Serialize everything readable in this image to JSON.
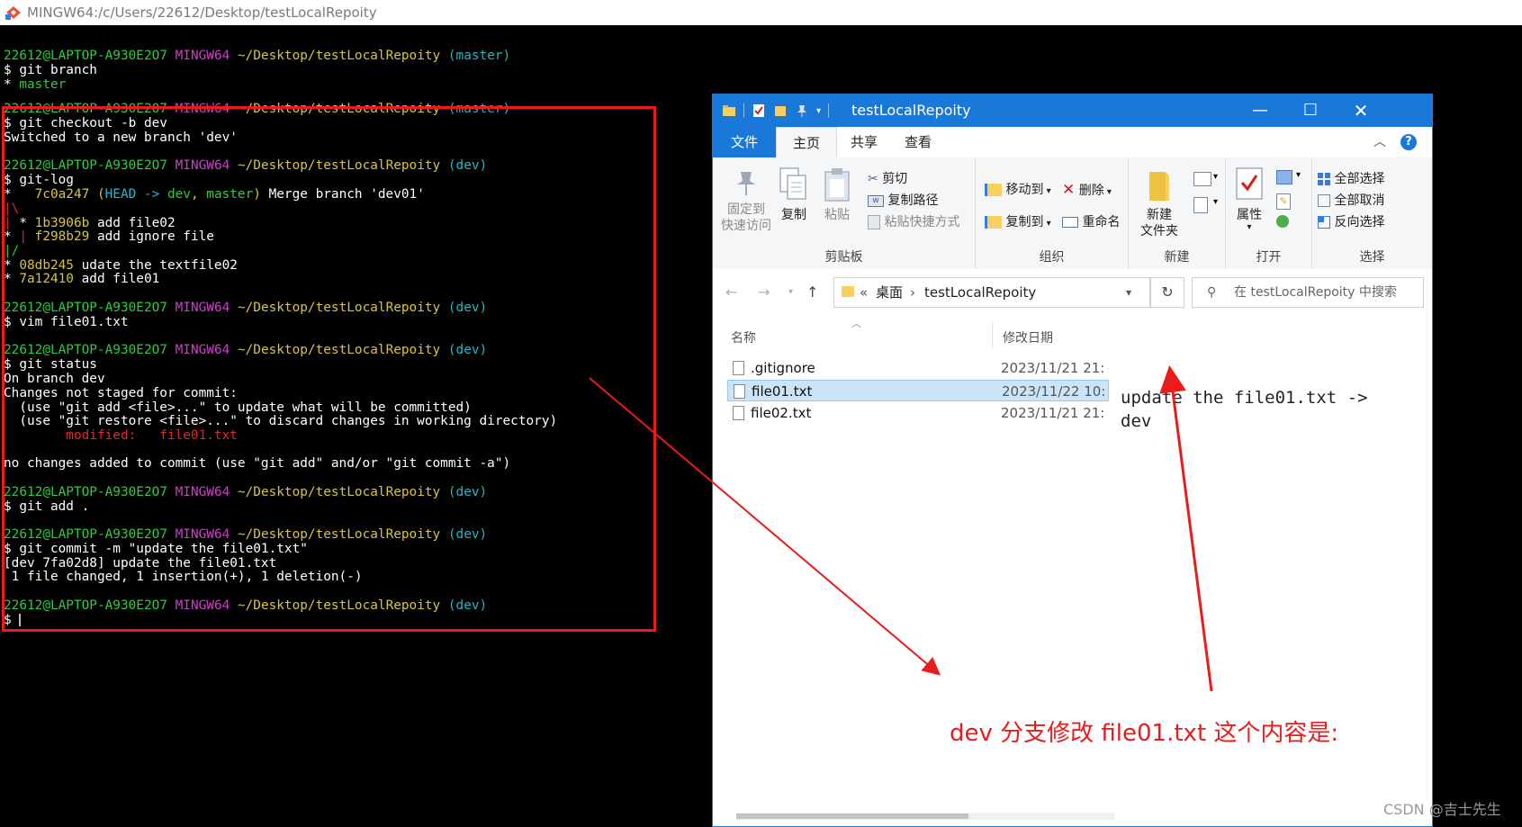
{
  "window_title": "MINGW64:/c/Users/22612/Desktop/testLocalRepoity",
  "terminal": {
    "lines": [
      {
        "prompt": {
          "user": "22612@LAPTOP-A930E2O7",
          "host": "MINGW64",
          "path": "~/Desktop/testLocalRepoity",
          "branch": "(master)"
        }
      },
      {
        "text": "$ git branch"
      },
      {
        "parts": [
          {
            "t": "* ",
            "cls": ""
          },
          {
            "t": "master",
            "cls": "g"
          }
        ]
      },
      {
        "prompt": {
          "user": "22612@LAPTOP-A930E2O7",
          "host": "MINGW64",
          "path": "~/Desktop/testLocalRepoity",
          "branch": "(master)"
        }
      },
      {
        "text": "$ git checkout -b dev"
      },
      {
        "text": "Switched to a new branch 'dev'"
      },
      {
        "prompt": {
          "user": "22612@LAPTOP-A930E2O7",
          "host": "MINGW64",
          "path": "~/Desktop/testLocalRepoity",
          "branch": "(dev)"
        }
      },
      {
        "text": "$ git-log"
      },
      {
        "parts": [
          {
            "t": "*   ",
            "cls": ""
          },
          {
            "t": "7c0a247",
            "cls": "y"
          },
          {
            "t": " (",
            "cls": "y"
          },
          {
            "t": "HEAD -> ",
            "cls": "c"
          },
          {
            "t": "dev",
            "cls": "g"
          },
          {
            "t": ", ",
            "cls": "y"
          },
          {
            "t": "master",
            "cls": "g"
          },
          {
            "t": ")",
            "cls": "y"
          },
          {
            "t": " Merge branch 'dev01'",
            "cls": ""
          }
        ]
      },
      {
        "parts": [
          {
            "t": "|\\",
            "cls": "r"
          }
        ]
      },
      {
        "parts": [
          {
            "t": "| ",
            "cls": "r"
          },
          {
            "t": "* ",
            "cls": ""
          },
          {
            "t": "1b3906b",
            "cls": "y"
          },
          {
            "t": " add file02",
            "cls": ""
          }
        ]
      },
      {
        "parts": [
          {
            "t": "* ",
            "cls": ""
          },
          {
            "t": "| ",
            "cls": "r"
          },
          {
            "t": "f298b29",
            "cls": "y"
          },
          {
            "t": " add ignore file",
            "cls": ""
          }
        ]
      },
      {
        "parts": [
          {
            "t": "|/",
            "cls": "g"
          }
        ]
      },
      {
        "parts": [
          {
            "t": "* ",
            "cls": ""
          },
          {
            "t": "08db245",
            "cls": "y"
          },
          {
            "t": " udate the textfile02",
            "cls": ""
          }
        ]
      },
      {
        "parts": [
          {
            "t": "* ",
            "cls": ""
          },
          {
            "t": "7a12410",
            "cls": "y"
          },
          {
            "t": " add file01",
            "cls": ""
          }
        ]
      },
      {
        "prompt": {
          "user": "22612@LAPTOP-A930E2O7",
          "host": "MINGW64",
          "path": "~/Desktop/testLocalRepoity",
          "branch": "(dev)"
        }
      },
      {
        "text": "$ vim file01.txt"
      },
      {
        "prompt": {
          "user": "22612@LAPTOP-A930E2O7",
          "host": "MINGW64",
          "path": "~/Desktop/testLocalRepoity",
          "branch": "(dev)"
        }
      },
      {
        "text": "$ git status"
      },
      {
        "text": "On branch dev"
      },
      {
        "text": "Changes not staged for commit:"
      },
      {
        "text": "  (use \"git add <file>...\" to update what will be committed)"
      },
      {
        "text": "  (use \"git restore <file>...\" to discard changes in working directory)"
      },
      {
        "parts": [
          {
            "t": "        modified:   file01.txt",
            "cls": "r"
          }
        ]
      },
      {
        "text": "no changes added to commit (use \"git add\" and/or \"git commit -a\")"
      },
      {
        "prompt": {
          "user": "22612@LAPTOP-A930E2O7",
          "host": "MINGW64",
          "path": "~/Desktop/testLocalRepoity",
          "branch": "(dev)"
        }
      },
      {
        "text": "$ git add ."
      },
      {
        "prompt": {
          "user": "22612@LAPTOP-A930E2O7",
          "host": "MINGW64",
          "path": "~/Desktop/testLocalRepoity",
          "branch": "(dev)"
        }
      },
      {
        "text": "$ git commit -m \"update the file01.txt\""
      },
      {
        "text": "[dev 7fa02d8] update the file01.txt"
      },
      {
        "text": " 1 file changed, 1 insertion(+), 1 deletion(-)"
      },
      {
        "prompt": {
          "user": "22612@LAPTOP-A930E2O7",
          "host": "MINGW64",
          "path": "~/Desktop/testLocalRepoity",
          "branch": "(dev)"
        }
      },
      {
        "text": "$ ",
        "cursor": true
      }
    ]
  },
  "explorer": {
    "title": "testLocalRepoity",
    "tabs": [
      "文件",
      "主页",
      "共享",
      "查看"
    ],
    "ribbon": {
      "pin": "固定到\n快速访问",
      "copy": "复制",
      "paste": "粘贴",
      "cut": "剪切",
      "copy_path": "复制路径",
      "paste_shortcut": "粘贴快捷方式",
      "clipboard_group": "剪贴板",
      "move_to": "移动到",
      "copy_to": "复制到",
      "delete": "删除",
      "rename": "重命名",
      "organize_group": "组织",
      "new_folder": "新建\n文件夹",
      "new_group": "新建",
      "properties": "属性",
      "open_group": "打开",
      "select_all": "全部选择",
      "select_none": "全部取消",
      "invert_selection": "反向选择",
      "select_group": "选择"
    },
    "address": {
      "prefix": "«",
      "crumb1": "桌面",
      "sep": "›",
      "crumb2": "testLocalRepoity"
    },
    "search_placeholder": "在 testLocalRepoity 中搜索",
    "columns": {
      "name": "名称",
      "date": "修改日期"
    },
    "files": [
      {
        "name": ".gitignore",
        "date": "2023/11/21 21:",
        "selected": false
      },
      {
        "name": "file01.txt",
        "date": "2023/11/22 10:",
        "selected": true
      },
      {
        "name": "file02.txt",
        "date": "2023/11/21 21:",
        "selected": false
      }
    ],
    "preview": {
      "line1": "update the file01.txt ->",
      "line2": "dev"
    }
  },
  "annotation": "dev 分支修改 file01.txt 这个内容是:",
  "watermark": "CSDN @吉士先生",
  "colors": {
    "annotation_red": "#e81c1c",
    "explorer_blue": "#1a78d8",
    "prompt_green": "#2ecc40",
    "prompt_magenta": "#cc40c8",
    "path_yellow": "#d8c440",
    "branch_cyan": "#22b8c8"
  }
}
